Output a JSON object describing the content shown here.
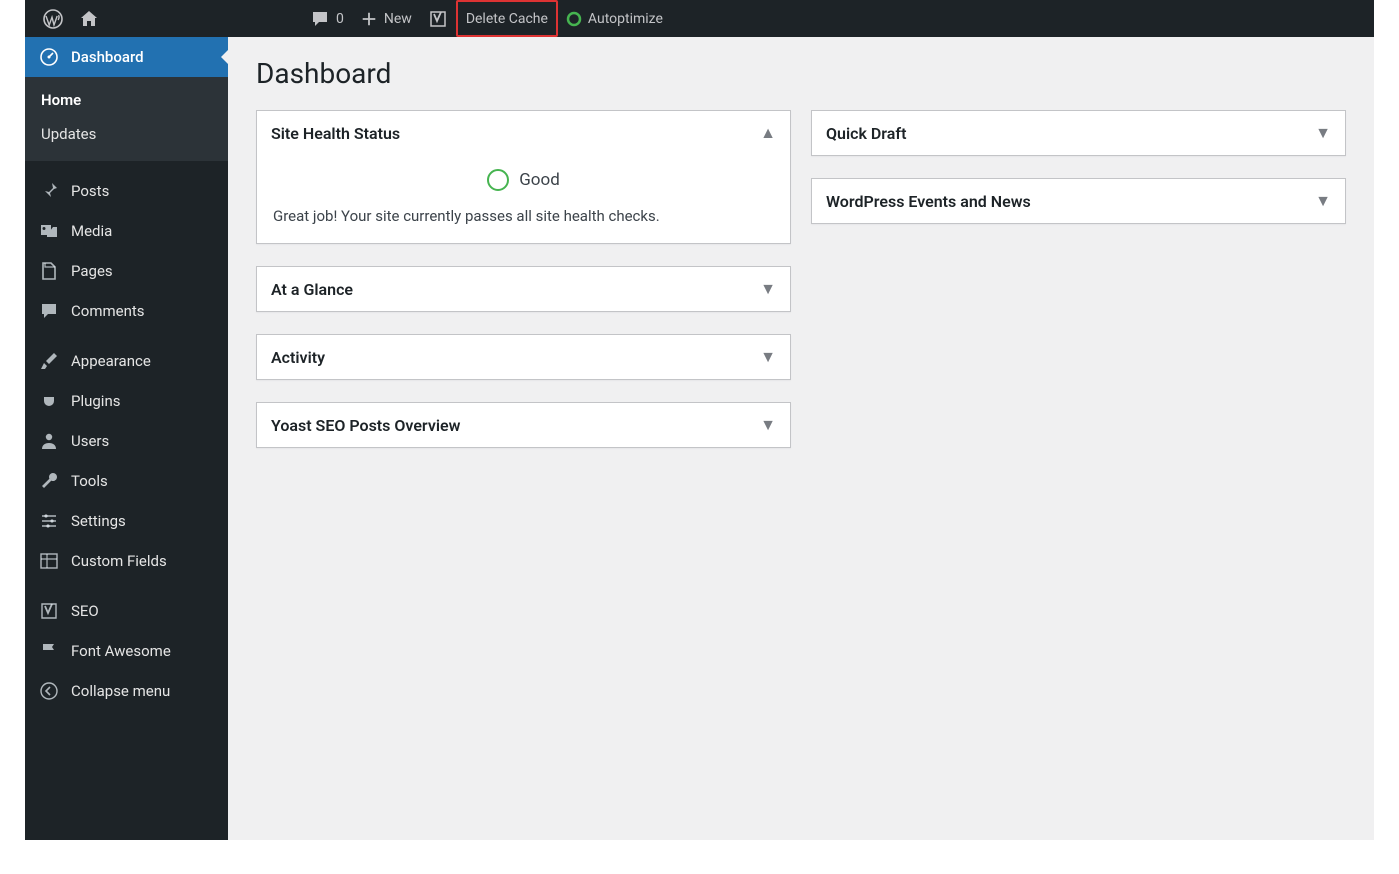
{
  "adminbar": {
    "comments_count": "0",
    "new_label": "New",
    "delete_cache_label": "Delete Cache",
    "autoptimize_label": "Autoptimize"
  },
  "sidebar": {
    "dashboard": "Dashboard",
    "submenu": {
      "home": "Home",
      "updates": "Updates"
    },
    "posts": "Posts",
    "media": "Media",
    "pages": "Pages",
    "comments": "Comments",
    "appearance": "Appearance",
    "plugins": "Plugins",
    "users": "Users",
    "tools": "Tools",
    "settings": "Settings",
    "custom_fields": "Custom Fields",
    "seo": "SEO",
    "font_awesome": "Font Awesome",
    "collapse": "Collapse menu"
  },
  "page_title": "Dashboard",
  "widgets": {
    "left": [
      {
        "title": "Site Health Status",
        "expanded": true,
        "health": {
          "status": "Good",
          "message": "Great job! Your site currently passes all site health checks."
        }
      },
      {
        "title": "At a Glance",
        "expanded": false
      },
      {
        "title": "Activity",
        "expanded": false
      },
      {
        "title": "Yoast SEO Posts Overview",
        "expanded": false
      }
    ],
    "right": [
      {
        "title": "Quick Draft",
        "expanded": false
      },
      {
        "title": "WordPress Events and News",
        "expanded": false
      }
    ]
  },
  "highlight": {
    "color": "#d33"
  }
}
